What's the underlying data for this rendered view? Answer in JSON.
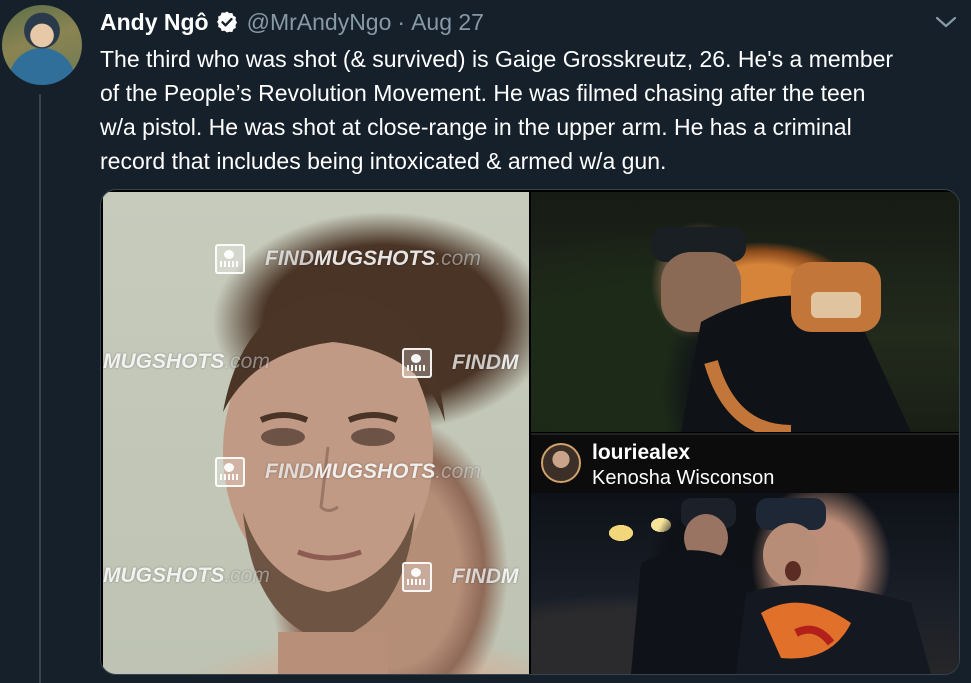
{
  "author": {
    "name": "Andy Ngô",
    "handle": "@MrAndyNgo",
    "separator": "·",
    "date": "Aug 27",
    "verified": true,
    "avatar_icon": "profile-avatar"
  },
  "tweet": {
    "text": "The third who was shot (& survived) is Gaige Grosskreutz, 26. He's a member\nof the People’s Revolution Movement. He was filmed chasing after the teen\nw/a pistol. He was shot at close-range in the upper arm. He has a criminal\nrecord that includes being intoxicated & armed w/a gun."
  },
  "media": {
    "watermarks": [
      {
        "find": "FIND",
        "brand": "MUGSHOTS",
        "suffix": ".com"
      },
      {
        "find": "",
        "brand": "MUGSHOTS",
        "suffix": ".com"
      },
      {
        "find": "FIND",
        "brand": "M",
        "suffix": ""
      },
      {
        "find": "FIND",
        "brand": "MUGSHOTS",
        "suffix": ".com"
      },
      {
        "find": "",
        "brand": "MUGSHOTS",
        "suffix": ".com"
      },
      {
        "find": "FIND",
        "brand": "M",
        "suffix": ""
      }
    ],
    "instagram": {
      "username": "louriealex",
      "location": "Kenosha Wisconson"
    }
  },
  "colors": {
    "background": "#15202b",
    "secondary_text": "#8899a6",
    "verified_badge": "#ffffff",
    "border": "#38444d"
  },
  "icons": {
    "verified": "verified-badge-icon",
    "menu": "chevron-down-icon"
  }
}
